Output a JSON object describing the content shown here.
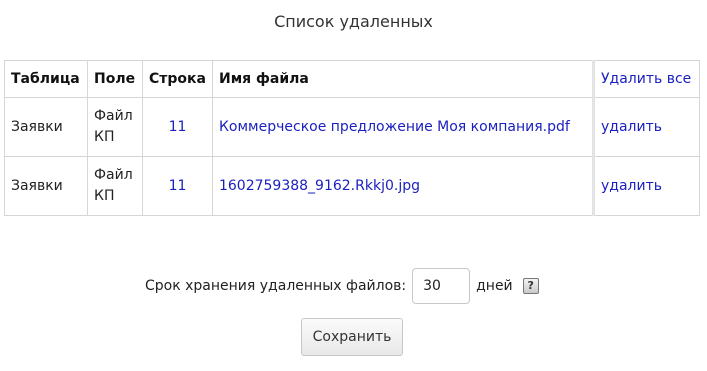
{
  "page": {
    "title": "Список удаленных"
  },
  "table": {
    "headers": {
      "table": "Таблица",
      "field": "Поле",
      "row": "Строка",
      "file": "Имя файла",
      "delete_all": "Удалить все"
    },
    "rows": [
      {
        "table": "Заявки",
        "field": "Файл КП",
        "row": "11",
        "file": "Коммерческое предложение Моя компания.pdf",
        "action": "удалить"
      },
      {
        "table": "Заявки",
        "field": "Файл КП",
        "row": "11",
        "file": "1602759388_9162.Rkkj0.jpg",
        "action": "удалить"
      }
    ]
  },
  "retention": {
    "label": "Срок хранения удаленных файлов:",
    "value": "30",
    "unit": "дней",
    "help": "?"
  },
  "save_label": "Сохранить",
  "colors": {
    "link": "#1a1fbf"
  }
}
